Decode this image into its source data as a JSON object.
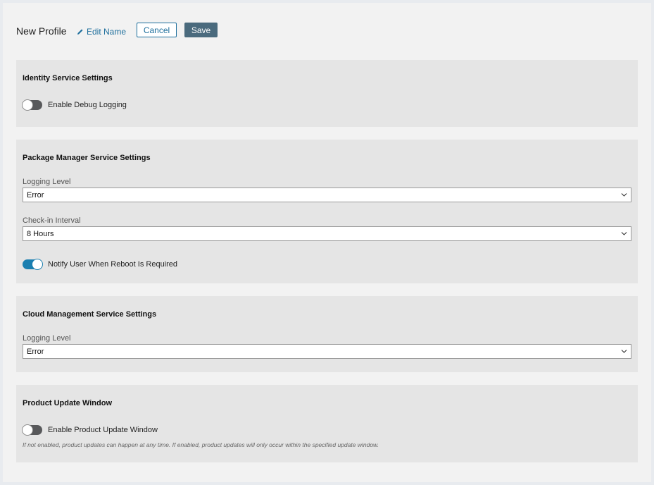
{
  "header": {
    "title": "New Profile",
    "edit_name": "Edit Name",
    "cancel": "Cancel",
    "save": "Save"
  },
  "identity": {
    "title": "Identity Service Settings",
    "debug_logging": {
      "label": "Enable Debug Logging",
      "enabled": false
    }
  },
  "package_manager": {
    "title": "Package Manager Service Settings",
    "logging_level": {
      "label": "Logging Level",
      "value": "Error"
    },
    "checkin_interval": {
      "label": "Check-in Interval",
      "value": "8 Hours"
    },
    "notify_reboot": {
      "label": "Notify User When Reboot Is Required",
      "enabled": true
    }
  },
  "cloud_management": {
    "title": "Cloud Management Service Settings",
    "logging_level": {
      "label": "Logging Level",
      "value": "Error"
    }
  },
  "product_update": {
    "title": "Product Update Window",
    "enable_window": {
      "label": "Enable Product Update Window",
      "enabled": false
    },
    "hint": "If not enabled, product updates can happen at any time. If enabled, product updates will only occur within the specified update window."
  },
  "colors": {
    "accent": "#1d6e9c",
    "save_button": "#4a6a7d",
    "toggle_on": "#1b7fb0",
    "toggle_off": "#58595b"
  },
  "icons": [
    "pencil-icon",
    "chevron-down-icon"
  ]
}
